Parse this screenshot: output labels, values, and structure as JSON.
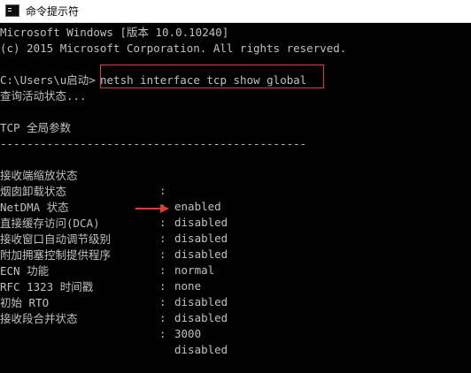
{
  "window": {
    "title": "命令提示符",
    "icon": "cmd-icon"
  },
  "console": {
    "lines": [
      "Microsoft Windows [版本 10.0.10240]",
      "(c) 2015 Microsoft Corporation. All rights reserved.",
      "",
      "C:\\Users\\u启动>",
      "查询活动状态...",
      "",
      "TCP 全局参数",
      "----------------------------------------------"
    ],
    "command": "netsh interface tcp show global",
    "params": [
      {
        "name": "接收端缩放状态",
        "sep": ":",
        "value": "enabled"
      },
      {
        "name": "烟囱卸载状态",
        "sep": ":",
        "value": "disabled"
      },
      {
        "name": "NetDMA 状态",
        "sep": ":",
        "value": "disabled"
      },
      {
        "name": "直接缓存访问(DCA)",
        "sep": ":",
        "value": "disabled"
      },
      {
        "name": "接收窗口自动调节级别",
        "sep": ":",
        "value": "normal"
      },
      {
        "name": "附加拥塞控制提供程序",
        "sep": ":",
        "value": "none"
      },
      {
        "name": "ECN 功能",
        "sep": ":",
        "value": "disabled"
      },
      {
        "name": "RFC 1323 时间戳",
        "sep": ":",
        "value": "disabled"
      },
      {
        "name": "初始 RTO",
        "sep": ":",
        "value": "3000"
      },
      {
        "name": "接收段合并状态",
        "sep": ":",
        "value": "disabled"
      }
    ]
  },
  "colors": {
    "console_bg": "#000000",
    "console_text": "#c0c0c0",
    "highlight": "#e53935"
  }
}
